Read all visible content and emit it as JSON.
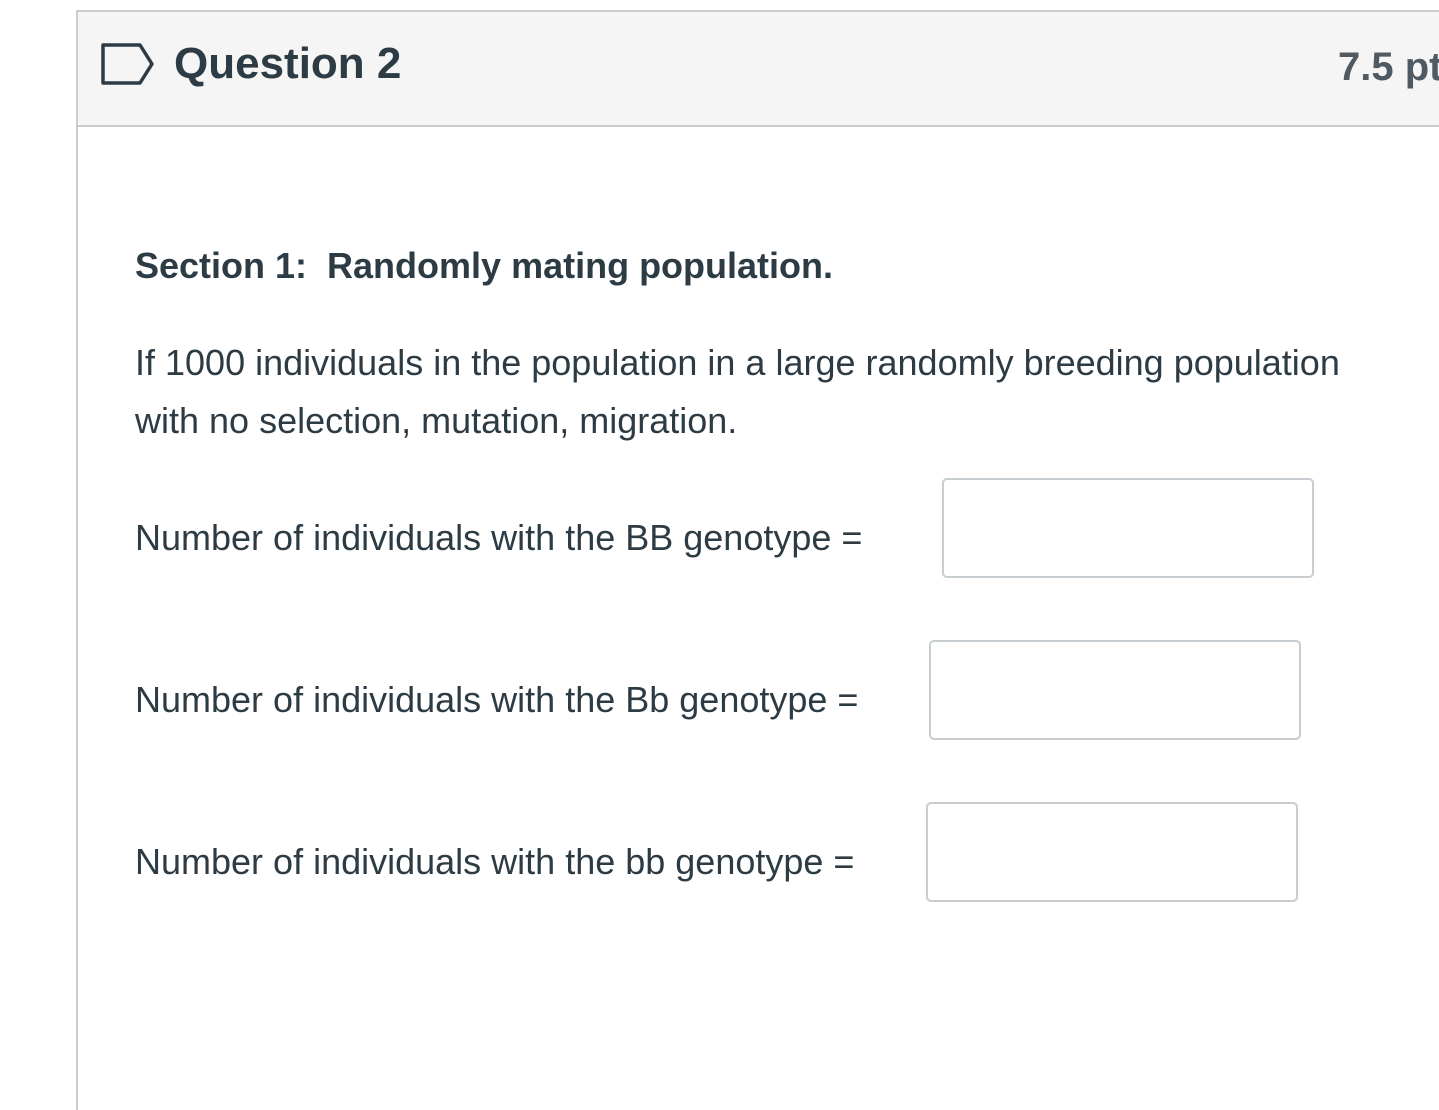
{
  "question": {
    "title": "Question 2",
    "points": "7.5 pt"
  },
  "section_heading": "Section 1:  Randomly mating population.",
  "prompt_lines": [
    "If 1000 individuals in the population in a large randomly breeding population",
    "with no selection, mutation, migration."
  ],
  "answers": [
    {
      "label": "Number of individuals with the BB genotype =",
      "value": ""
    },
    {
      "label": "Number of individuals with the Bb genotype =",
      "value": ""
    },
    {
      "label": "Number of individuals with the bb genotype =",
      "value": ""
    }
  ],
  "icons": {
    "flag": "flag-outline-icon"
  },
  "colors": {
    "text": "#2d3b45",
    "header_bg": "#f5f5f5",
    "border": "#c7cdd1",
    "flag_stroke": "#2d3b45"
  }
}
